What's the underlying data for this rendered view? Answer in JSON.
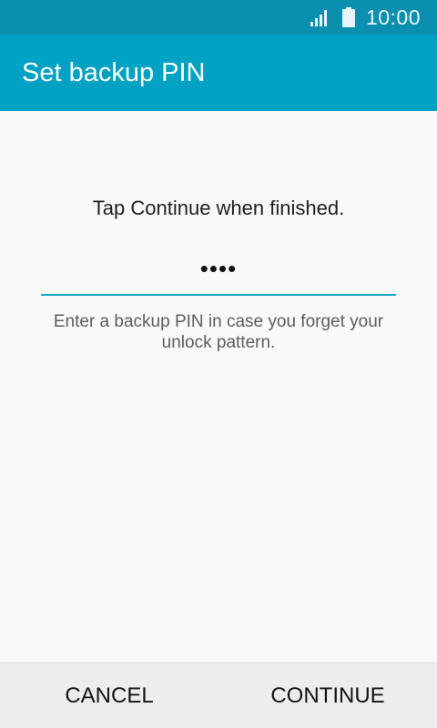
{
  "status_bar": {
    "time": "10:00",
    "icons": [
      "signal-icon",
      "battery-icon"
    ]
  },
  "app_bar": {
    "title": "Set backup PIN"
  },
  "main": {
    "instruction": "Tap Continue when finished.",
    "pin_field": {
      "value": "••••"
    },
    "hint": "Enter a backup PIN in case you forget your unlock pattern."
  },
  "bottom_bar": {
    "cancel_label": "CANCEL",
    "continue_label": "CONTINUE"
  },
  "colors": {
    "status_bar": "#0a8fae",
    "app_bar": "#00a2c3",
    "accent": "#14a6c6",
    "background": "#f9f9f9",
    "bottom_bar": "#ededed"
  }
}
